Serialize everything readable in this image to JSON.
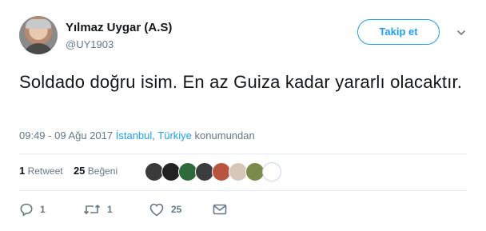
{
  "user": {
    "name": "Yılmaz Uygar (A.S)",
    "handle": "@UY1903",
    "follow_label": "Takip et"
  },
  "tweet": {
    "text": "Soldado doğru isim. En az Guiza kadar yararlı olacaktır."
  },
  "meta": {
    "datetime": "09:49 - 09 Ağu 2017",
    "city": "İstanbul",
    "comma": ",",
    "country": "Türkiye",
    "suffix": "konumundan"
  },
  "stats": {
    "retweets_count": "1",
    "retweets_label": "Retweet",
    "likes_count": "25",
    "likes_label": "Beğeni"
  },
  "liker_avatars": [
    {
      "name": "liker-avatar-1",
      "color": "#3a3a3a"
    },
    {
      "name": "liker-avatar-2",
      "color": "#222222"
    },
    {
      "name": "liker-avatar-3",
      "color": "#2f6b3a"
    },
    {
      "name": "liker-avatar-4",
      "color": "#3c3c3c"
    },
    {
      "name": "liker-avatar-5",
      "color": "#b8533f"
    },
    {
      "name": "liker-avatar-6",
      "color": "#d7c7b8"
    },
    {
      "name": "liker-avatar-7",
      "color": "#7b8a4b"
    },
    {
      "name": "liker-avatar-8",
      "color": "#ffffff"
    }
  ],
  "actions": {
    "reply_count": "1",
    "retweet_count": "1",
    "like_count": "25"
  },
  "colors": {
    "accent": "#1da1f2",
    "secondary_text": "#657786"
  }
}
